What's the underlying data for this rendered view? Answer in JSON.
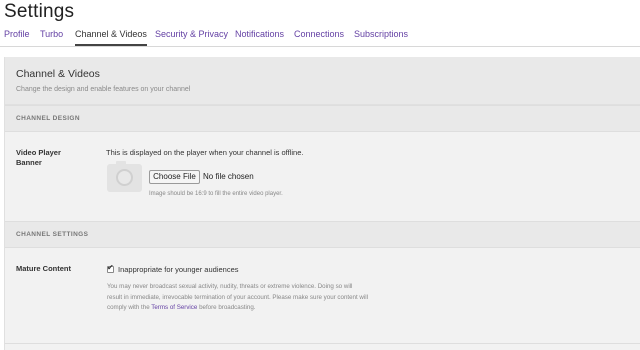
{
  "page": {
    "title": "Settings"
  },
  "tabs": [
    {
      "label": "Profile"
    },
    {
      "label": "Turbo"
    },
    {
      "label": "Channel & Videos"
    },
    {
      "label": "Security & Privacy"
    },
    {
      "label": "Notifications"
    },
    {
      "label": "Connections"
    },
    {
      "label": "Subscriptions"
    }
  ],
  "panel": {
    "title": "Channel & Videos",
    "subtitle": "Change the design and enable features on your channel"
  },
  "channel_design": {
    "heading": "CHANNEL DESIGN",
    "label_line1": "Video Player",
    "label_line2": "Banner",
    "description": "This is displayed on the player when your channel is offline.",
    "file_button": "Choose File",
    "file_status": "No file chosen",
    "hint": "Image should be 16:9 to fill the entire video player."
  },
  "channel_settings": {
    "heading": "CHANNEL SETTINGS",
    "label": "Mature Content",
    "checkbox_label": "Inappropriate for younger audiences",
    "checkbox_checked": true,
    "warning_line1": "You may never broadcast sexual activity, nudity, threats or extreme violence. Doing so will",
    "warning_line2": "result in immediate, irrevocable termination of your account. Please make sure your content will",
    "warning_line3_prefix": "comply with the",
    "terms_link": "Terms of Service",
    "warning_line3_suffix": "before broadcasting."
  },
  "colors": {
    "accent": "#6441a4",
    "panel_bg": "#f2f2f2",
    "header_bg": "#e9e9e9"
  }
}
